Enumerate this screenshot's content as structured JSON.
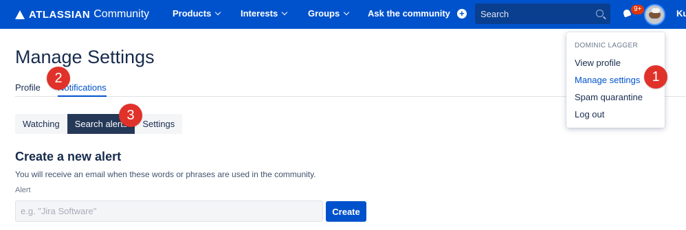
{
  "nav": {
    "logo_bold": "ATLASSIAN",
    "logo_light": "Community",
    "products": "Products",
    "interests": "Interests",
    "groups": "Groups",
    "ask": "Ask the community",
    "search_placeholder": "Search",
    "notification_count": "9+",
    "user_short": "Ku"
  },
  "page": {
    "title": "Manage Settings",
    "tabs": [
      {
        "label": "Profile",
        "active": false
      },
      {
        "label": "Notifications",
        "active": true
      }
    ],
    "subtabs": [
      {
        "label": "Watching",
        "selected": false
      },
      {
        "label": "Search alerts",
        "selected": true
      },
      {
        "label": "Settings",
        "selected": false
      }
    ],
    "section_title": "Create a new alert",
    "description": "You will receive an email when these words or phrases are used in the community.",
    "alert_label": "Alert",
    "alert_placeholder": "e.g. \"Jira Software\"",
    "alert_value": "",
    "create_label": "Create"
  },
  "dropdown": {
    "header": "DOMINIC LAGGER",
    "items": [
      {
        "label": "View profile",
        "active": false
      },
      {
        "label": "Manage settings",
        "active": true
      },
      {
        "label": "Spam quarantine",
        "active": false
      },
      {
        "label": "Log out",
        "active": false
      }
    ]
  },
  "markers": [
    "1",
    "2",
    "3"
  ],
  "colors": {
    "brand": "#0052cc",
    "marker": "#e0322a",
    "selected_subtab": "#253858"
  }
}
